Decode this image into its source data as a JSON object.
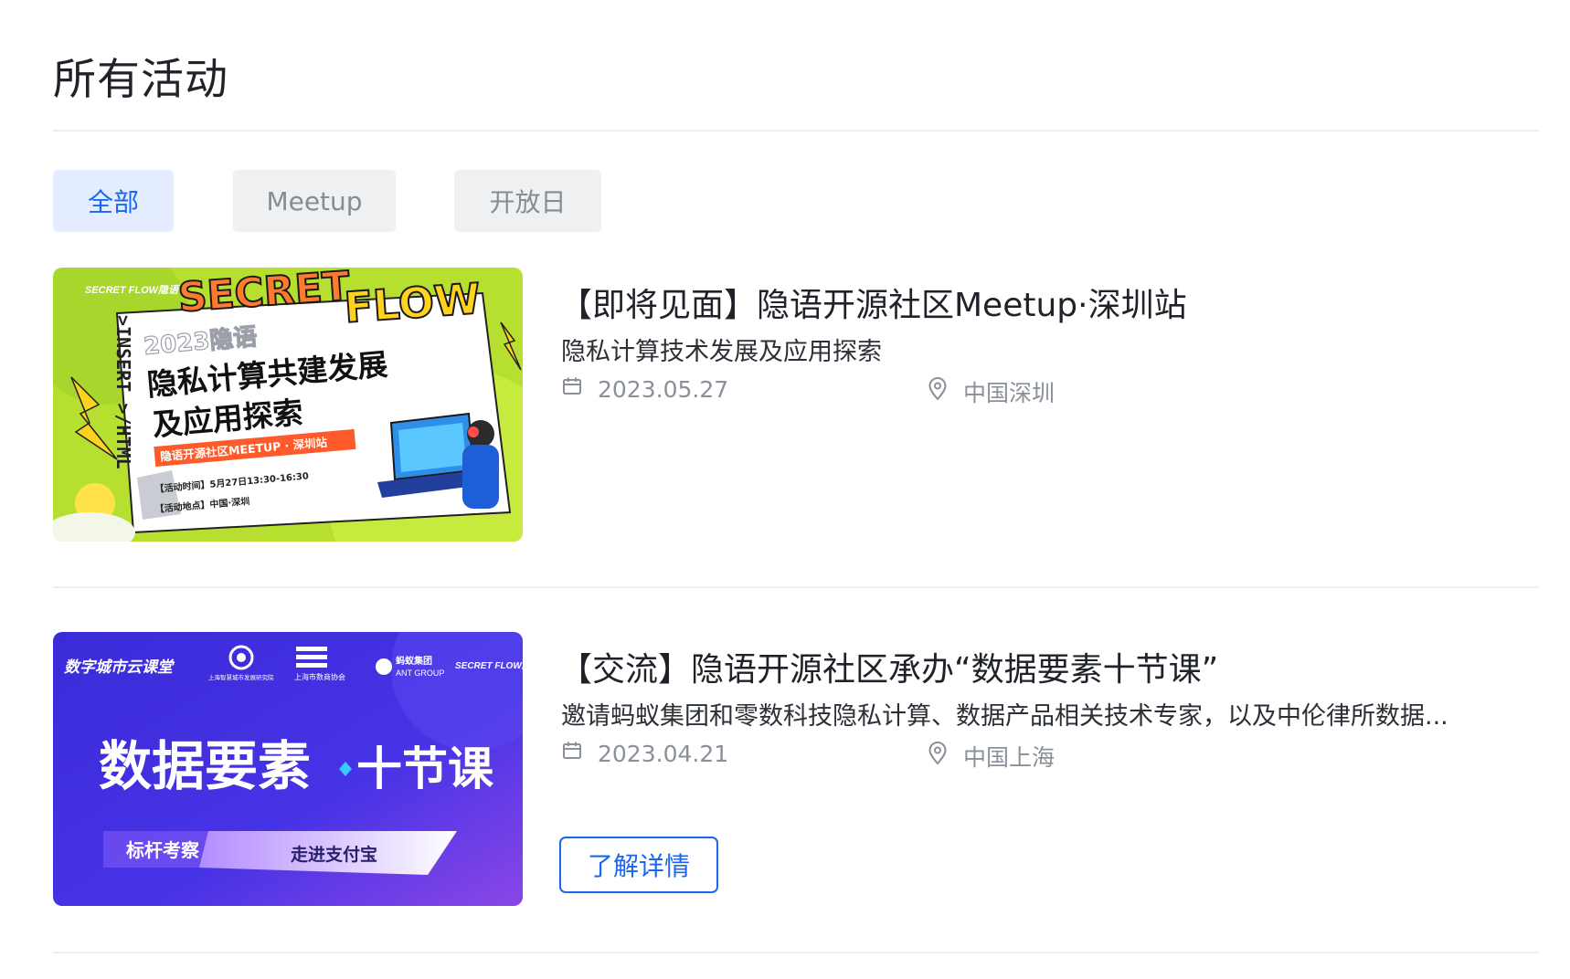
{
  "page": {
    "title": "所有活动"
  },
  "tabs": [
    {
      "label": "全部",
      "active": true
    },
    {
      "label": "Meetup",
      "active": false
    },
    {
      "label": "开放日",
      "active": false
    }
  ],
  "events": [
    {
      "title": "【即将见面】隐语开源社区Meetup·深圳站",
      "description": "隐私计算技术发展及应用探索",
      "date": "2023.05.27",
      "location": "中国深圳",
      "poster": {
        "brand": "SECRET FLOW隐语",
        "word_secret": "SECRET",
        "word_flow": "FLOW",
        "code_text": ">INSERT >/HTML",
        "year_text": "2023隐语",
        "headline_1": "隐私计算共建发展",
        "headline_2": "及应用探索",
        "ribbon": "隐语开源社区MEETUP · 深圳站",
        "time_line": "【活动时间】5月27日13:30-16:30",
        "place_line": "【活动地点】中国·深圳"
      }
    },
    {
      "title": "【交流】隐语开源社区承办“数据要素十节课”",
      "description": "邀请蚂蚁集团和零数科技隐私计算、数据产品相关技术专家，以及中伦律所数据...",
      "date": "2023.04.21",
      "location": "中国上海",
      "button_label": "了解详情",
      "poster": {
        "series": "数字城市云课堂",
        "org_1": "上海智慧城市发展研究院",
        "org_2": "上海市数商协会",
        "org_3_cn": "蚂蚁集团",
        "org_3_en": "ANT GROUP",
        "org_4": "SECRET FLOW隐语",
        "headline_a": "数据要素",
        "headline_b": "十节课",
        "tag_left": "标杆考察",
        "tag_right": "走进支付宝"
      }
    }
  ],
  "colors": {
    "accent": "#1a67ee",
    "tab_active_bg": "#e3edff",
    "tab_bg": "#eff0f2"
  },
  "icons": {
    "date": "calendar-icon",
    "location": "location-pin-icon"
  }
}
